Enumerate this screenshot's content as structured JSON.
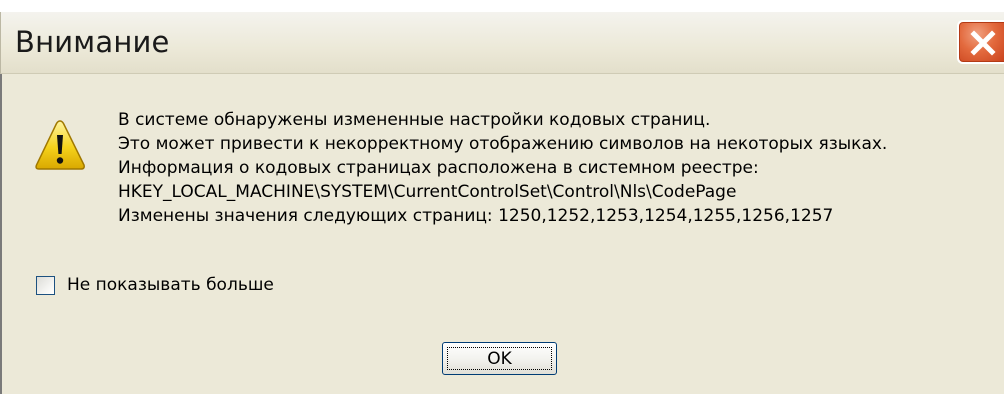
{
  "dialog": {
    "title": "Внимание",
    "message_lines": [
      "В системе обнаружены измененные настройки кодовых страниц.",
      "Это может привести к некорректному отображению символов на некоторых языках.",
      "Информация о кодовых страницах расположена в системном реестре:",
      "HKEY_LOCAL_MACHINE\\SYSTEM\\CurrentControlSet\\Control\\Nls\\CodePage",
      "Изменены значения следующих страниц: 1250,1252,1253,1254,1255,1256,1257"
    ],
    "checkbox_label": "Не показывать больше",
    "checkbox_checked": false,
    "ok_label": "OK",
    "icons": {
      "close": "close-icon",
      "warning": "warning-icon"
    },
    "colors": {
      "background": "#ece9d8",
      "close_button": "#e36a3e",
      "warning_yellow": "#f5d21b"
    }
  }
}
